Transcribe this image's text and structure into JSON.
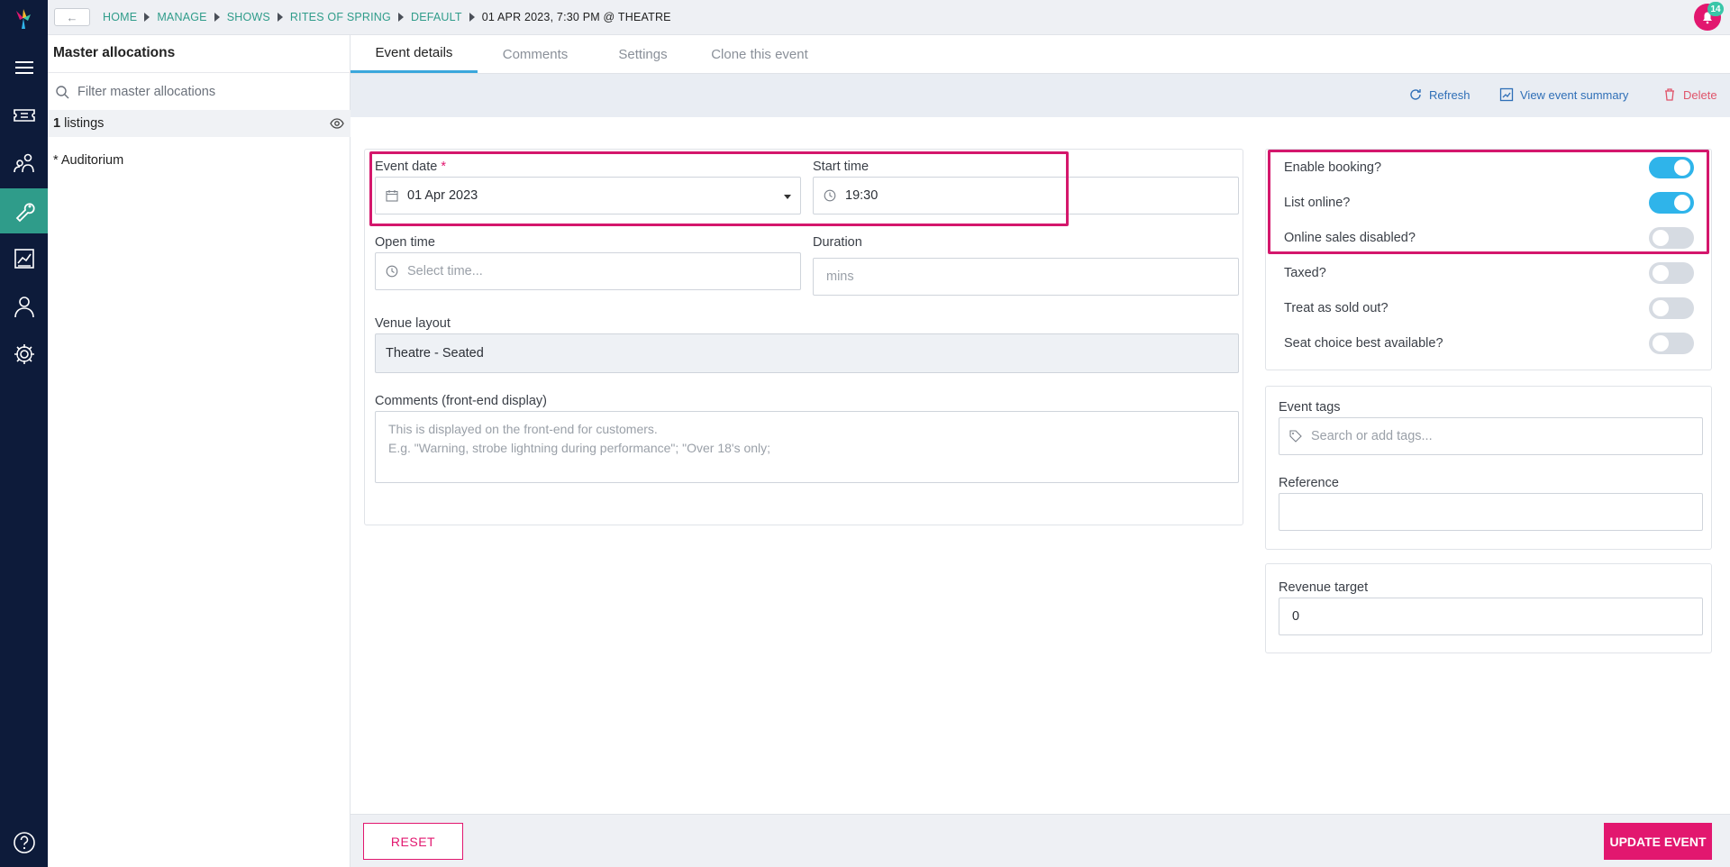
{
  "colors": {
    "rail": "#0d1b3a",
    "rail_active": "#2f9c8a",
    "accent_pink": "#e2176f",
    "toggle_on": "#2fb4ea",
    "link": "#2f6fb7",
    "breadcrumb": "#2f9c8a"
  },
  "rail": {
    "icons": [
      "menu-icon",
      "ticket-icon",
      "customers-icon",
      "wrench-icon",
      "report-icon",
      "user-icon",
      "gear-icon",
      "help-icon"
    ],
    "active": "wrench-icon"
  },
  "topbar": {
    "back_label": "←",
    "breadcrumb": [
      "HOME",
      "MANAGE",
      "SHOWS",
      "RITES OF SPRING",
      "DEFAULT",
      "01 APR 2023, 7:30 PM @ THEATRE"
    ],
    "notification_count": "14"
  },
  "master": {
    "title": "Master allocations",
    "filter_placeholder": "Filter master allocations",
    "listings_count": "1",
    "listings_label": " listings",
    "items": [
      "* Auditorium"
    ]
  },
  "tabs": [
    "Event details",
    "Comments",
    "Settings",
    "Clone this event"
  ],
  "active_tab": "Event details",
  "actions": {
    "refresh": "Refresh",
    "view_summary": "View event summary",
    "delete": "Delete"
  },
  "form": {
    "event_date": {
      "label": "Event date",
      "required": "*",
      "value": "01 Apr 2023"
    },
    "start_time": {
      "label": "Start time",
      "value": "19:30"
    },
    "open_time": {
      "label": "Open time",
      "placeholder": "Select time..."
    },
    "duration": {
      "label": "Duration",
      "placeholder": "mins"
    },
    "venue_layout": {
      "label": "Venue layout",
      "value": "Theatre - Seated"
    },
    "comments": {
      "label": "Comments (front-end display)",
      "placeholder_line1": "This is displayed on the front-end for customers.",
      "placeholder_line2": "E.g. \"Warning, strobe lightning during performance\"; \"Over 18's only;"
    }
  },
  "toggles": [
    {
      "label": "Enable booking?",
      "on": true
    },
    {
      "label": "List online?",
      "on": true
    },
    {
      "label": "Online sales disabled?",
      "on": false
    },
    {
      "label": "Taxed?",
      "on": false
    },
    {
      "label": "Treat as sold out?",
      "on": false
    },
    {
      "label": "Seat choice best available?",
      "on": false
    }
  ],
  "tags": {
    "label": "Event tags",
    "placeholder": "Search or add tags..."
  },
  "reference": {
    "label": "Reference",
    "value": ""
  },
  "revenue": {
    "label": "Revenue target",
    "value": "0"
  },
  "footer": {
    "reset": "RESET",
    "update": "UPDATE EVENT"
  }
}
